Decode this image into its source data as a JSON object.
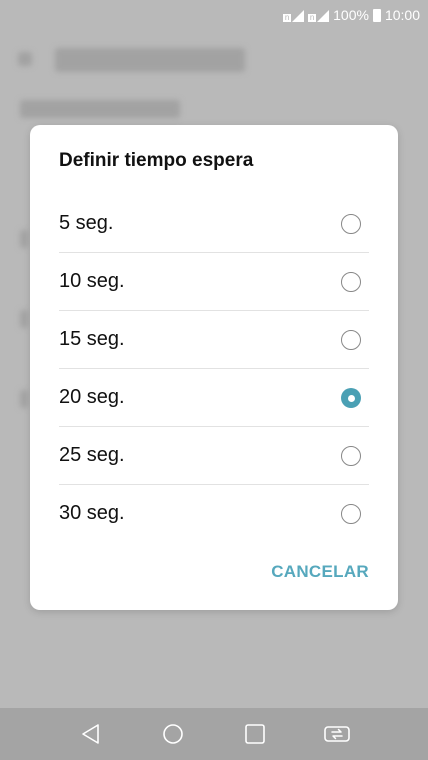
{
  "status_bar": {
    "battery_text": "100%",
    "time": "10:00",
    "sim1_label": "n",
    "sim2_label": "n"
  },
  "dialog": {
    "title": "Definir tiempo espera",
    "options": [
      {
        "label": "5 seg.",
        "checked": false
      },
      {
        "label": "10 seg.",
        "checked": false
      },
      {
        "label": "15 seg.",
        "checked": false
      },
      {
        "label": "20 seg.",
        "checked": true
      },
      {
        "label": "25 seg.",
        "checked": false
      },
      {
        "label": "30 seg.",
        "checked": false
      }
    ],
    "cancel_label": "CANCELAR"
  },
  "colors": {
    "accent": "#4aa0b4",
    "cancel": "#56a8bd",
    "scrim": "#b9b9b9"
  },
  "nav": {
    "icons": [
      "back-icon",
      "home-icon",
      "recents-icon",
      "dual-window-icon"
    ]
  }
}
